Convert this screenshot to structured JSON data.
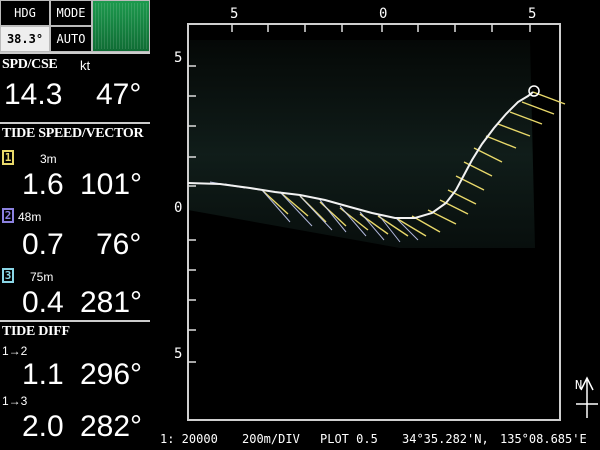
{
  "header": {
    "hdg_label": "HDG",
    "hdg_value": "38.3°",
    "mode_label": "MODE",
    "mode_value": "AUTO"
  },
  "spd_cse": {
    "title": "SPD/CSE",
    "unit": "kt",
    "speed": "14.3",
    "course": "47°"
  },
  "tide_vector": {
    "title": "TIDE SPEED/VECTOR",
    "layers": [
      {
        "index": "1",
        "depth": "3m",
        "speed": "1.6",
        "dir": "101°",
        "color": "#e8d86a"
      },
      {
        "index": "2",
        "depth": "48m",
        "speed": "0.7",
        "dir": "76°",
        "color": "#8c82e0"
      },
      {
        "index": "3",
        "depth": "75m",
        "speed": "0.4",
        "dir": "281°",
        "color": "#8ad6e6"
      }
    ]
  },
  "tide_diff": {
    "title": "TIDE DIFF",
    "rows": [
      {
        "label": "1→2",
        "speed": "1.1",
        "dir": "296°"
      },
      {
        "label": "1→3",
        "speed": "2.0",
        "dir": "282°"
      }
    ]
  },
  "plot": {
    "top_ticks": [
      "5",
      "0",
      "5"
    ],
    "left_ticks": [
      "5",
      "0",
      "5"
    ],
    "north_label": "N"
  },
  "status": {
    "scale": "1: 20000",
    "div": "200m/DIV",
    "plot": "PLOT 0.5",
    "lat": "34°35.282'N,",
    "lon": "135°08.685'E"
  }
}
